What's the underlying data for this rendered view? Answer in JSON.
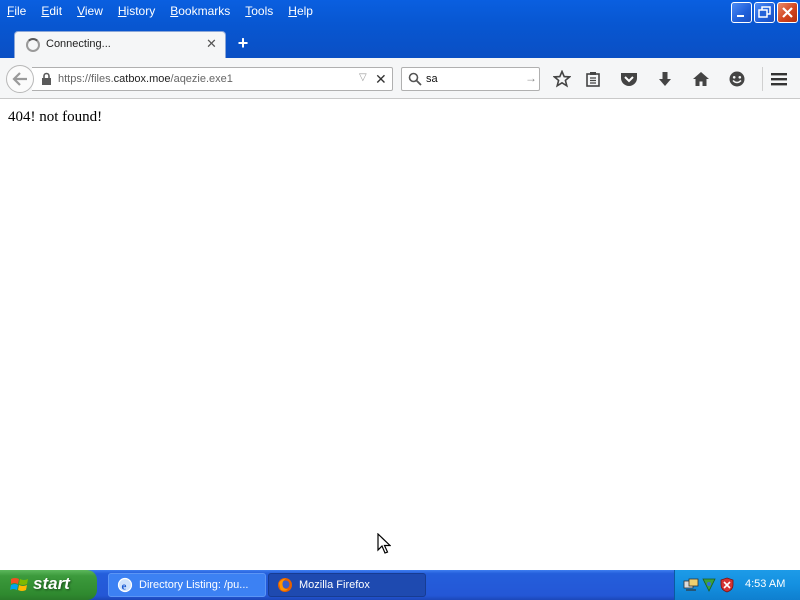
{
  "menu": [
    "File",
    "Edit",
    "View",
    "History",
    "Bookmarks",
    "Tools",
    "Help"
  ],
  "menu_underline": [
    "F",
    "E",
    "V",
    "H",
    "B",
    "T",
    "H"
  ],
  "tab": {
    "title": "Connecting..."
  },
  "urlbar": {
    "prefix": "https://files.",
    "host": "catbox.moe",
    "path": "/aqezie.exe1"
  },
  "search": {
    "value": "sa"
  },
  "content": {
    "text": "404! not found!"
  },
  "taskbar": {
    "start_label": "start",
    "tasks": [
      {
        "label": "Directory Listing: /pu..."
      },
      {
        "label": "Mozilla Firefox"
      }
    ],
    "clock": "4:53 AM"
  },
  "colors": {
    "titlebar": "#0857d2",
    "taskbar": "#245edb",
    "start": "#3c9a3c",
    "tray": "#1490e0"
  }
}
